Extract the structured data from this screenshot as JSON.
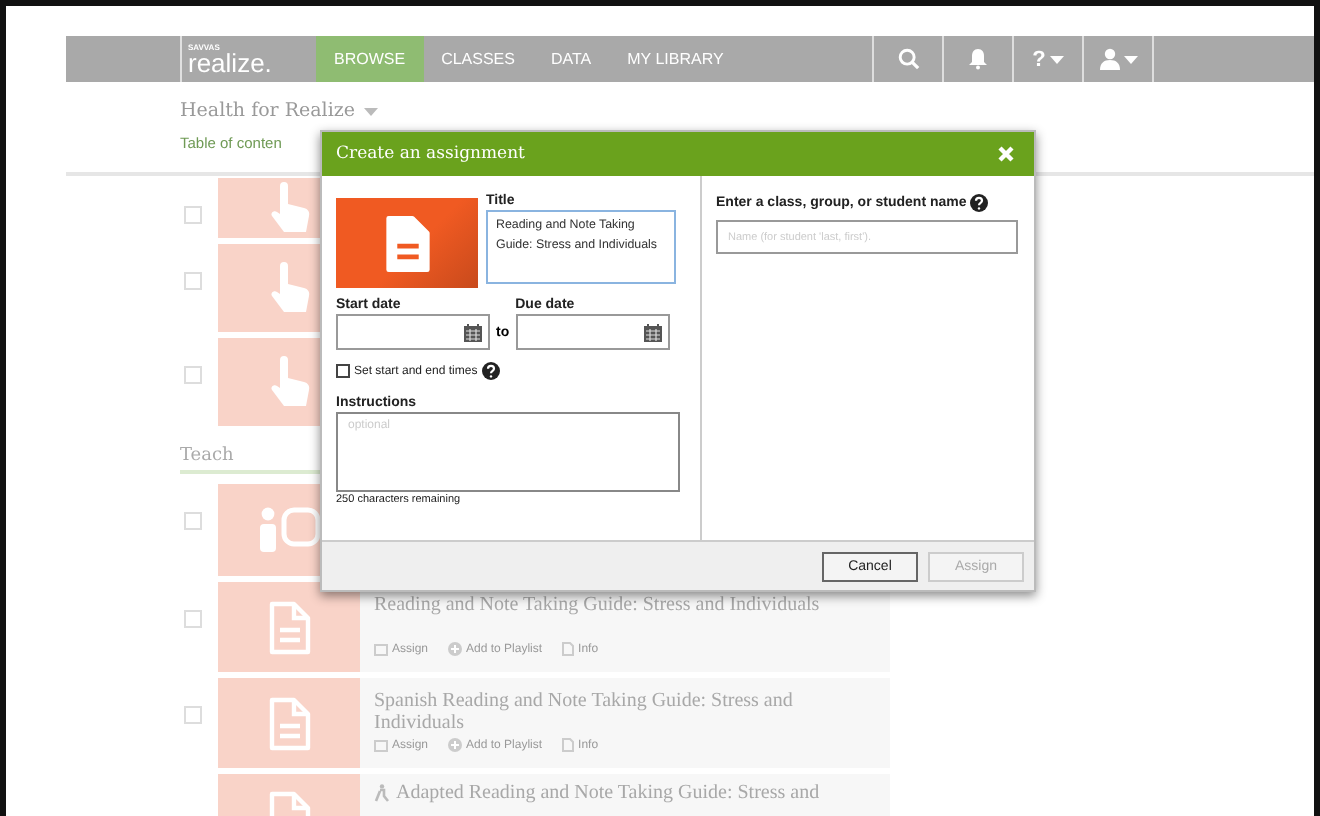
{
  "nav": {
    "logo_small": "SAVVAS",
    "logo": "realize.",
    "help": "?",
    "tabs": [
      {
        "label": "BROWSE",
        "selected": true
      },
      {
        "label": "CLASSES",
        "selected": false
      },
      {
        "label": "DATA",
        "selected": false
      },
      {
        "label": "MY LIBRARY",
        "selected": false
      }
    ]
  },
  "header": {
    "title": "Health for Realize",
    "subtitle": "Table of conten"
  },
  "list": [
    {
      "kind": "interactive",
      "checked": false
    },
    {
      "kind": "interactive",
      "checked": false
    },
    {
      "kind": "interactive",
      "checked": false
    },
    {
      "kind": "heading",
      "text": "Teach"
    },
    {
      "kind": "teacher",
      "checked": false
    },
    {
      "kind": "document",
      "checked": false,
      "title": "Reading and Note Taking Guide: Stress and Individuals",
      "actions": [
        "Assign",
        "Add to Playlist",
        "Info"
      ]
    },
    {
      "kind": "document",
      "checked": false,
      "title": "Spanish Reading and Note Taking Guide: Stress and Individuals",
      "actions": [
        "Assign",
        "Add to Playlist",
        "Info"
      ]
    },
    {
      "kind": "adapted",
      "title": "Adapted Reading and Note Taking Guide: Stress and"
    }
  ],
  "modal": {
    "title": "Create an assignment",
    "title_label": "Title",
    "title_value": "Reading and Note Taking Guide: Stress and Individuals",
    "start_label": "Start date",
    "due_label": "Due date",
    "to": "to",
    "times_label": "Set start and end times",
    "times_checked": false,
    "instructions_label": "Instructions",
    "instructions_placeholder": "optional",
    "remaining": "250 characters remaining",
    "recipient_label": "Enter a class, group, or student name",
    "recipient_placeholder": "Name (for student 'last, first').",
    "buttons": [
      {
        "label": "Cancel",
        "disabled": false
      },
      {
        "label": "Assign",
        "disabled": true
      }
    ]
  }
}
